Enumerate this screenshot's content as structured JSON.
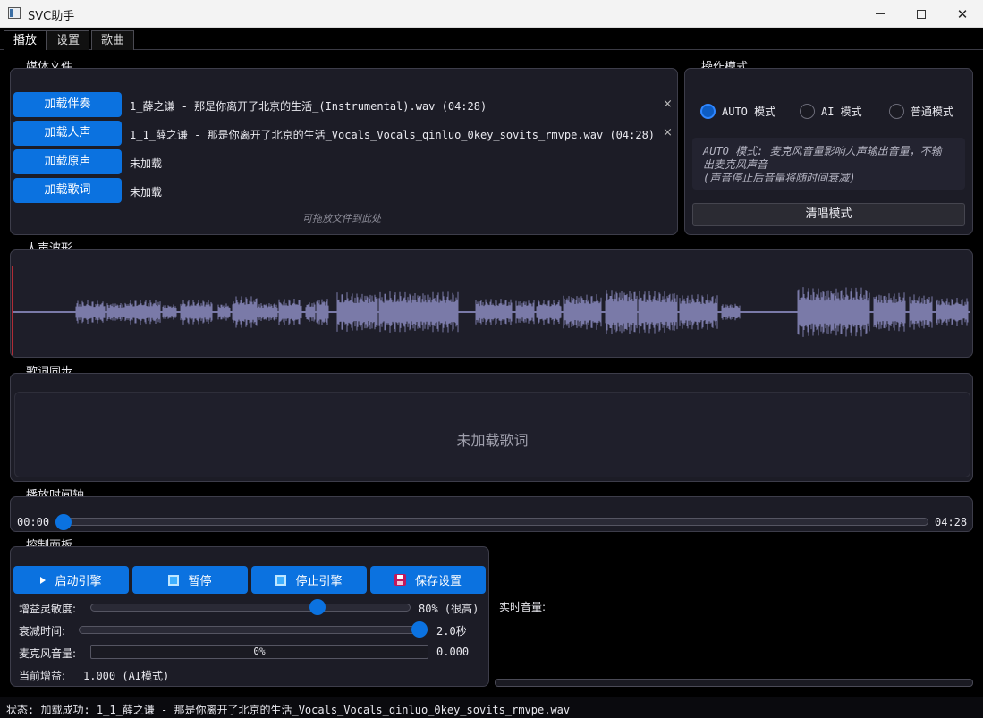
{
  "window": {
    "title": "SVC助手"
  },
  "tabs": [
    {
      "label": "播放"
    },
    {
      "label": "设置"
    },
    {
      "label": "歌曲"
    }
  ],
  "media": {
    "title": "媒体文件",
    "rows": [
      {
        "button": "加载伴奏",
        "file": "1_薛之谦 - 那是你离开了北京的生活_(Instrumental).wav (04:28)",
        "closable": true
      },
      {
        "button": "加载人声",
        "file": "1_1_薛之谦 - 那是你离开了北京的生活_Vocals_Vocals_qinluo_0key_sovits_rmvpe.wav (04:28)",
        "closable": true
      },
      {
        "button": "加载原声",
        "file": "未加载",
        "closable": false
      },
      {
        "button": "加载歌词",
        "file": "未加载",
        "closable": false
      }
    ],
    "close_glyph": "×",
    "drop_hint": "可拖放文件到此处"
  },
  "mode": {
    "title": "操作模式",
    "options": [
      {
        "label": "AUTO 模式",
        "checked": true
      },
      {
        "label": "AI 模式",
        "checked": false
      },
      {
        "label": "普通模式",
        "checked": false
      }
    ],
    "description_line1": "AUTO 模式: 麦克风音量影响人声输出音量，不输",
    "description_line2": "出麦克风声音",
    "description_line3": "(声音停止后音量将随时间衰减)",
    "clear_button": "清唱模式"
  },
  "waveform": {
    "title": "人声波形",
    "color": "#7a7aa8",
    "playhead_color": "#e0303a",
    "playhead_fraction": 0
  },
  "lyrics": {
    "title": "歌词同步",
    "empty_text": "未加载歌词"
  },
  "timeline": {
    "title": "播放时间轴",
    "current": "00:00",
    "total": "04:28",
    "progress_fraction": 0
  },
  "control": {
    "title": "控制面板",
    "buttons": [
      {
        "label": "启动引擎",
        "icon": "play-icon"
      },
      {
        "label": "暂停",
        "icon": "pause-square-icon"
      },
      {
        "label": "停止引擎",
        "icon": "stop-square-icon"
      },
      {
        "label": "保存设置",
        "icon": "floppy-icon"
      }
    ],
    "gain_label": "增益灵敏度:",
    "gain_value": "80% (很高)",
    "gain_fraction": 0.8,
    "decay_label": "衰减时间:",
    "decay_value": "2.0秒",
    "decay_fraction": 1.0,
    "mic_label": "麦克风音量:",
    "mic_bar_text": "0%",
    "mic_value": "0.000",
    "current_gain_label": "当前增益:",
    "current_gain_value": "1.000 (AI模式)"
  },
  "realtime": {
    "label": "实时音量:",
    "level_fraction": 0
  },
  "status": {
    "text": "状态: 加载成功: 1_1_薛之谦 - 那是你离开了北京的生活_Vocals_Vocals_qinluo_0key_sovits_rmvpe.wav"
  },
  "colors": {
    "accent": "#0b72e0",
    "panel": "#1c1c26",
    "border": "#3d3d4a"
  }
}
